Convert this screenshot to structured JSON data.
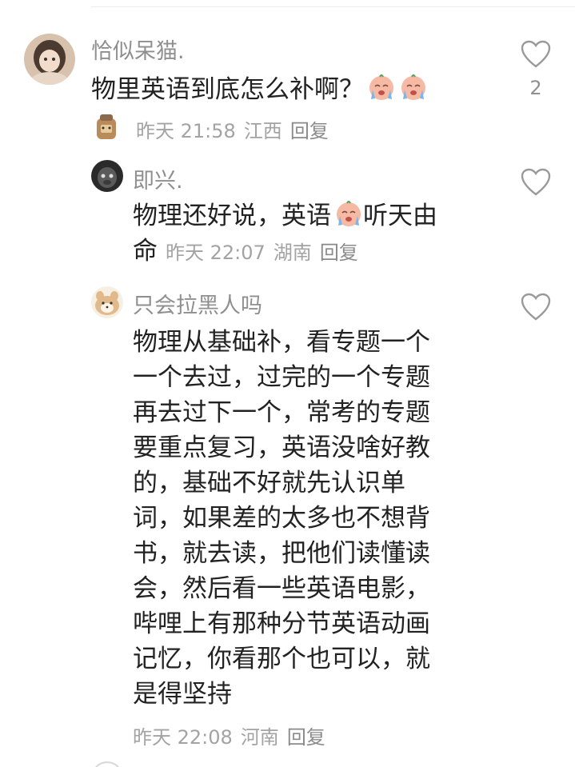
{
  "comments": [
    {
      "username": "恰似呆猫.",
      "text": "物里英语到底怎么补啊？",
      "emoji": [
        "crying-face-emoji",
        "crying-face-emoji"
      ],
      "meta": {
        "date": "昨天",
        "time": "21:58",
        "location": "江西",
        "reply": "回复"
      },
      "likes": "2"
    },
    {
      "username": "即兴.",
      "text_before_emoji": "物理还好说，英语",
      "text_after_emoji": "听天由",
      "text_line2": "命",
      "emoji": [
        "crying-face-emoji"
      ],
      "meta": {
        "date": "昨天",
        "time": "22:07",
        "location": "湖南",
        "reply": "回复"
      }
    },
    {
      "username": "只会拉黑人吗",
      "text_lines": [
        "物理从基础补，看专题一个",
        "一个去过，过完的一个专题",
        "再去过下一个，常考的专题",
        "要重点复习，英语没啥好教",
        "的，基础不好就先认识单",
        "词，如果差的太多也不想背",
        "书，就去读，把他们读懂读",
        "会，然后看一些英语电影，",
        "哔哩上有那种分节英语动画",
        "记忆，你看那个也可以，就",
        "是得坚持"
      ],
      "meta": {
        "date": "昨天",
        "time": "22:08",
        "location": "河南",
        "reply": "回复"
      }
    }
  ],
  "colors": {
    "username": "#8f8f8f",
    "text": "#222222",
    "meta": "#a3a3a3",
    "icon": "#9a9a9a"
  }
}
